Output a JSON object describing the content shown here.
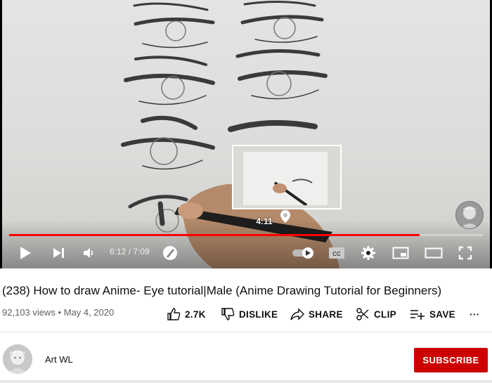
{
  "player": {
    "preview_time": "4:11",
    "time_display": "6:12 / 7:09",
    "progress_fraction": 0.867,
    "accent_color": "#ff0000",
    "icons": {
      "play": "play-icon",
      "next": "next-icon",
      "volume": "volume-icon",
      "autoplay": "autoplay-toggle-icon",
      "captions": "cc-icon",
      "settings": "gear-icon",
      "miniplayer": "miniplayer-icon",
      "theater": "theater-icon",
      "fullscreen": "fullscreen-icon"
    }
  },
  "video": {
    "title": "(238) How to draw Anime- Eye tutorial|Male (Anime Drawing Tutorial for Beginners)",
    "views": "92,103 views",
    "date": "May 4, 2020"
  },
  "actions": {
    "like": "2.7K",
    "dislike": "DISLIKE",
    "share": "SHARE",
    "clip": "CLIP",
    "save": "SAVE",
    "more": "···"
  },
  "channel": {
    "name": "Art WL",
    "subscribe": "SUBSCRIBE",
    "subscribe_color": "#cc0000"
  }
}
